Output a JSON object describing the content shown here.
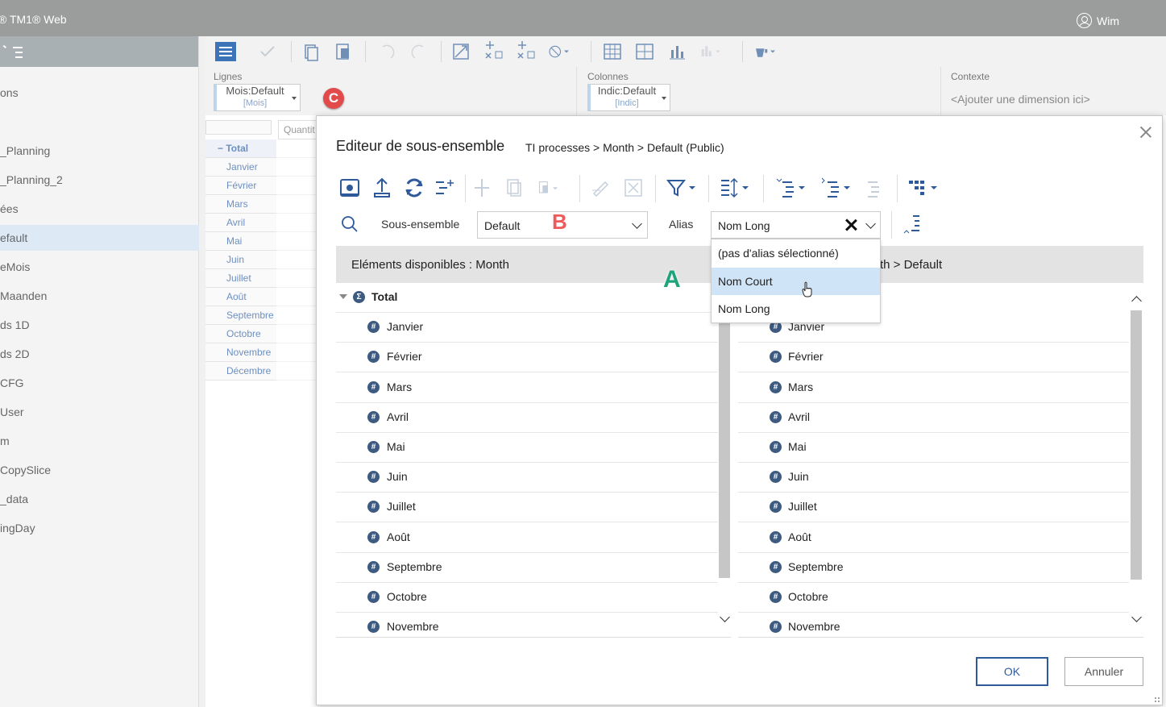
{
  "app": {
    "title": "® TM1® Web",
    "user": "Wim"
  },
  "sidebar": {
    "items": [
      {
        "label": "ons"
      },
      {
        "label": ""
      },
      {
        "label": "_Planning"
      },
      {
        "label": "_Planning_2"
      },
      {
        "label": "ées"
      },
      {
        "label": "efault",
        "active": true
      },
      {
        "label": "eMois"
      },
      {
        "label": "Maanden"
      },
      {
        "label": "ds 1D"
      },
      {
        "label": "ds 2D"
      },
      {
        "label": "CFG"
      },
      {
        "label": "User"
      },
      {
        "label": "m"
      },
      {
        "label": "CopySlice"
      },
      {
        "label": "_data"
      },
      {
        "label": "ingDay"
      }
    ]
  },
  "dims": {
    "rows_label": "Lignes",
    "rows_token": "Mois:Default",
    "rows_sub": "[Mois]",
    "cols_label": "Colonnes",
    "cols_token": "Indic:Default",
    "cols_sub": "[Indic]",
    "context_label": "Contexte",
    "context_placeholder": "<Ajouter une dimension ici>"
  },
  "grid": {
    "col_header": "Quantit",
    "rows": [
      "Total",
      "Janvier",
      "Février",
      "Mars",
      "Avril",
      "Mai",
      "Juin",
      "Juillet",
      "Août",
      "Septembre",
      "Octobre",
      "Novembre",
      "Décembre"
    ]
  },
  "annotations": {
    "a": "A",
    "b": "B",
    "c": "C"
  },
  "dialog": {
    "title": "Editeur de sous-ensemble",
    "path": "TI processes > Month > Default (Public)",
    "subset_label": "Sous-ensemble",
    "subset_value": "Default",
    "alias_label": "Alias",
    "alias_value": "Nom Long",
    "left_header": "Eléments disponibles : Month",
    "right_header": "th > Default",
    "left_items": [
      "Total",
      "Janvier",
      "Février",
      "Mars",
      "Avril",
      "Mai",
      "Juin",
      "Juillet",
      "Août",
      "Septembre",
      "Octobre",
      "Novembre"
    ],
    "right_items": [
      "Janvier",
      "Février",
      "Mars",
      "Avril",
      "Mai",
      "Juin",
      "Juillet",
      "Août",
      "Septembre",
      "Octobre",
      "Novembre"
    ],
    "alias_options": [
      "(pas d'alias sélectionné)",
      "Nom Court",
      "Nom Long"
    ],
    "ok": "OK",
    "cancel": "Annuler"
  },
  "colors": {
    "topbar": "#9b9c9c",
    "accent": "#2e5a9c",
    "icon_blue": "#3d74b8",
    "hover": "#cfe4f7"
  }
}
